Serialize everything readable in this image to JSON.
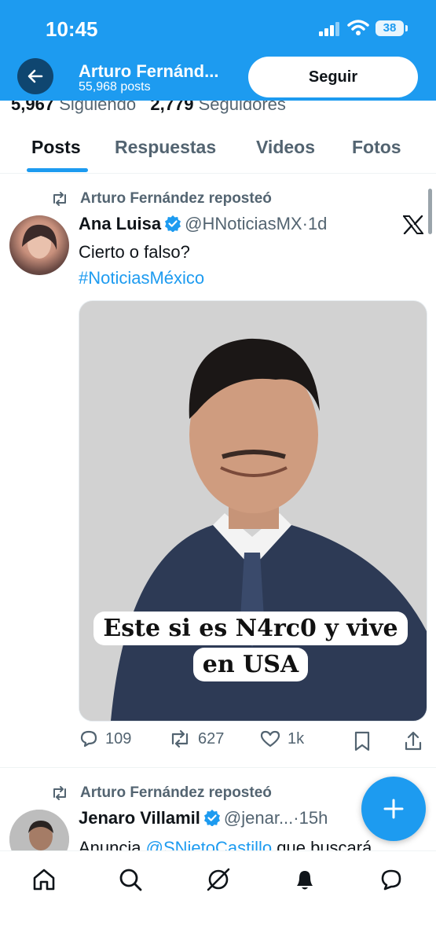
{
  "status_bar": {
    "time": "10:45",
    "battery": "38"
  },
  "header": {
    "name": "Arturo Fernánd...",
    "posts": "55,968 posts",
    "follow_label": "Seguir"
  },
  "profile_stats": {
    "following_count": "5,967",
    "following_label": "Siguiendo",
    "followers_count": "2,779",
    "followers_label": "Seguidores"
  },
  "tabs": [
    {
      "label": "Posts",
      "active": true
    },
    {
      "label": "Respuestas",
      "active": false
    },
    {
      "label": "Videos",
      "active": false
    },
    {
      "label": "Fotos",
      "active": false
    }
  ],
  "posts": [
    {
      "repost_label": "Arturo Fernández reposteó",
      "author": "Ana Luisa",
      "handle": "@HNoticiasMX",
      "time": "1d",
      "text": "Cierto o falso?",
      "hashtag": "#NoticiasMéxico",
      "media_caption": "Este si es N4rc0 y vive en USA",
      "replies": "109",
      "reposts": "627",
      "likes": "1k"
    },
    {
      "repost_label": "Arturo Fernández reposteó",
      "author": "Jenaro Villamil",
      "handle": "@jenar...",
      "time": "15h",
      "text_prefix": "Anuncia",
      "mention": "@SNietoCastillo",
      "text_suffix": "que buscará"
    }
  ],
  "icons": {
    "back": "arrow-left-icon",
    "verified": "verified-badge-icon",
    "repost": "repost-icon",
    "x_logo": "x-logo-icon",
    "compose": "plus-icon",
    "nav": [
      "home-icon",
      "search-icon",
      "grok-icon",
      "notifications-icon",
      "messages-icon"
    ]
  },
  "colors": {
    "brand": "#1d9bf0",
    "text": "#0f1419",
    "muted": "#536471"
  }
}
